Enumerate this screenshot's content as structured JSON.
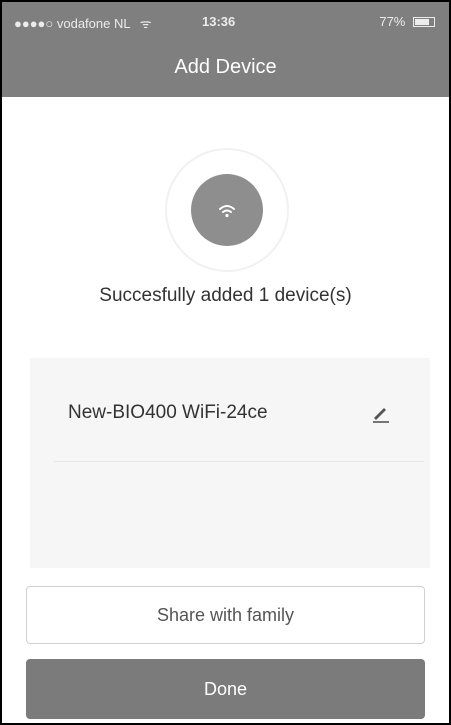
{
  "status_bar": {
    "carrier": "●●●●○ vodafone NL",
    "wifi_glyph": "ᯤ",
    "time": "13:36",
    "battery": "77%"
  },
  "header": {
    "title": "Add Device"
  },
  "success_text": "Succesfully added 1 device(s)",
  "device": {
    "name": "New-BIO400 WiFi-24ce"
  },
  "buttons": {
    "share": "Share with family",
    "done": "Done"
  },
  "colors": {
    "header": "#7f7f7f",
    "done_button": "#7b7b7b",
    "icon_circle": "#8e8e8e"
  }
}
